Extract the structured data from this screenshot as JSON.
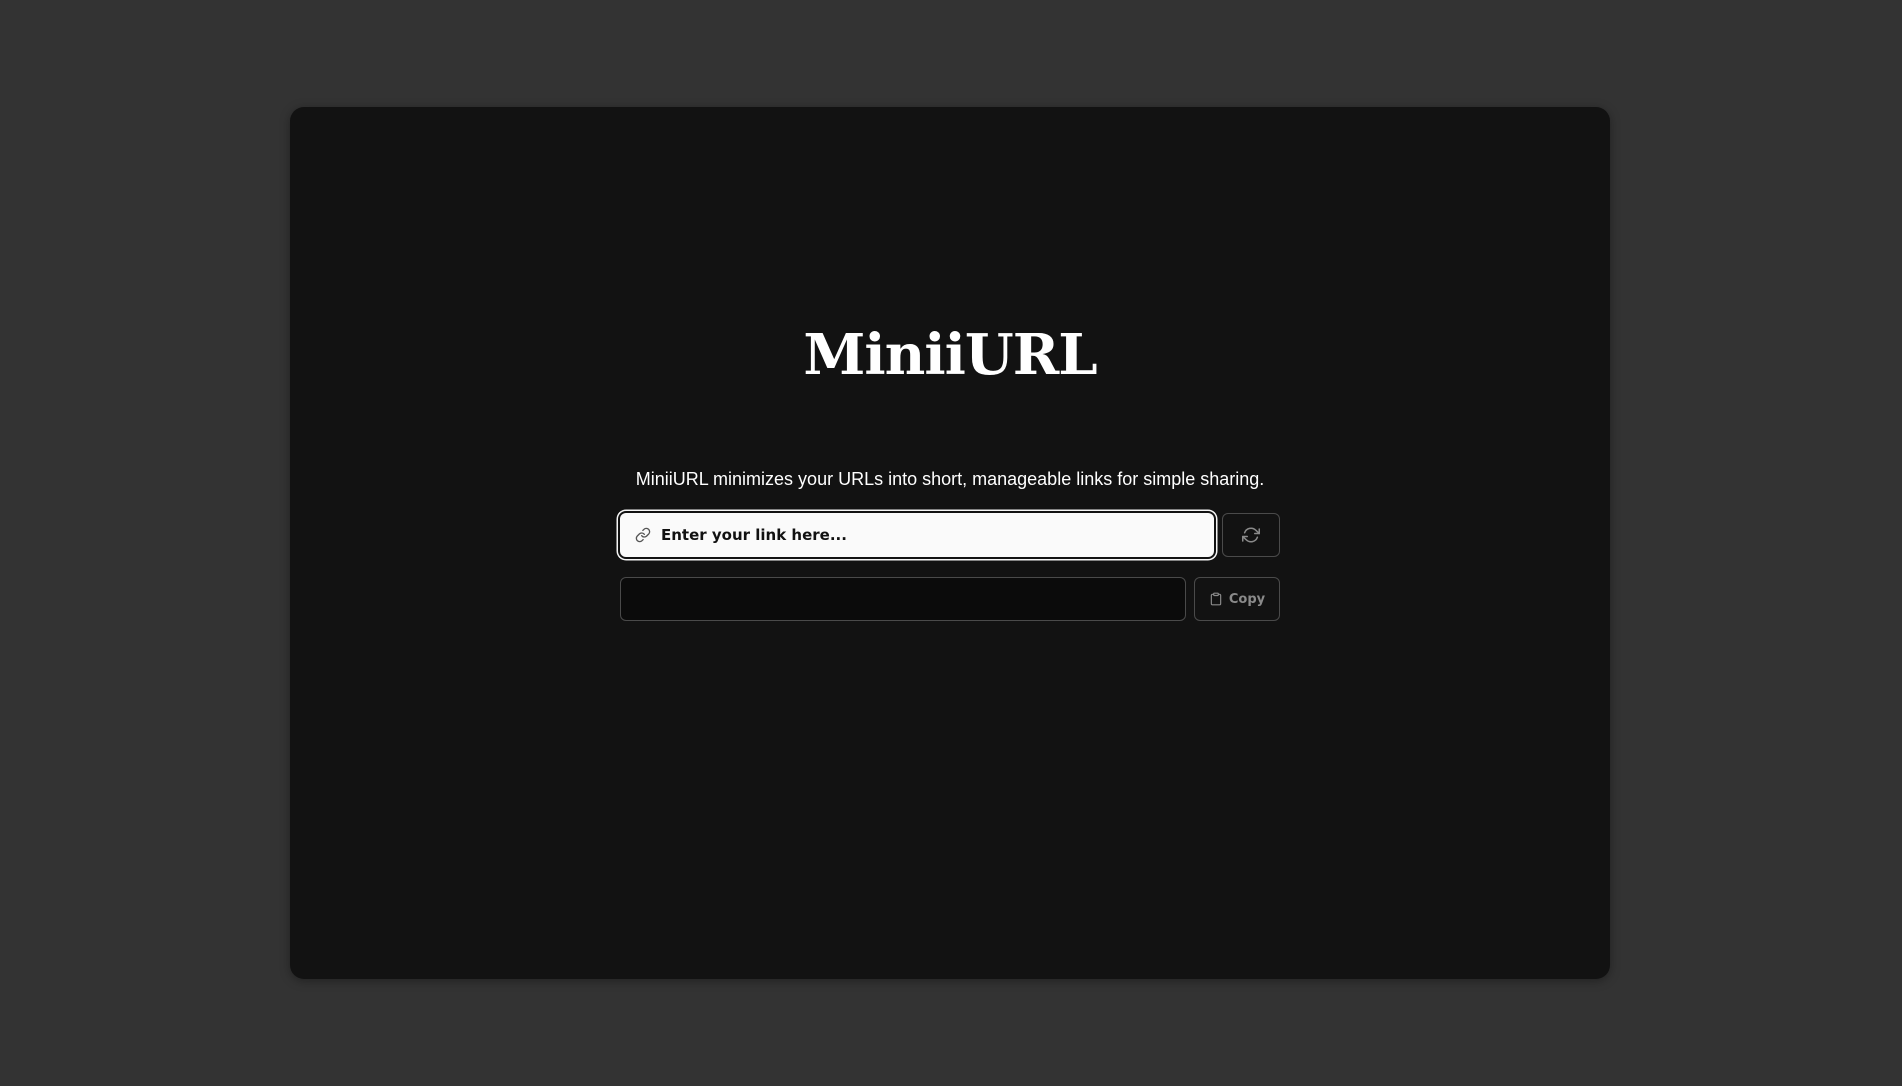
{
  "app": {
    "title": "MiniiURL",
    "tagline": "MiniiURL minimizes your URLs into short, manageable links for simple sharing."
  },
  "shortener": {
    "input_placeholder": "Enter your link here...",
    "input_value": "",
    "input_icon": "link-icon",
    "refresh_icon": "refresh-icon",
    "output_value": "",
    "copy_label": "Copy",
    "copy_icon": "clipboard-icon"
  },
  "colors": {
    "page_background": "#333333",
    "card_background": "#121212",
    "input_background": "#fafafa",
    "text_primary": "#ffffff",
    "muted": "#8a8a8a"
  }
}
